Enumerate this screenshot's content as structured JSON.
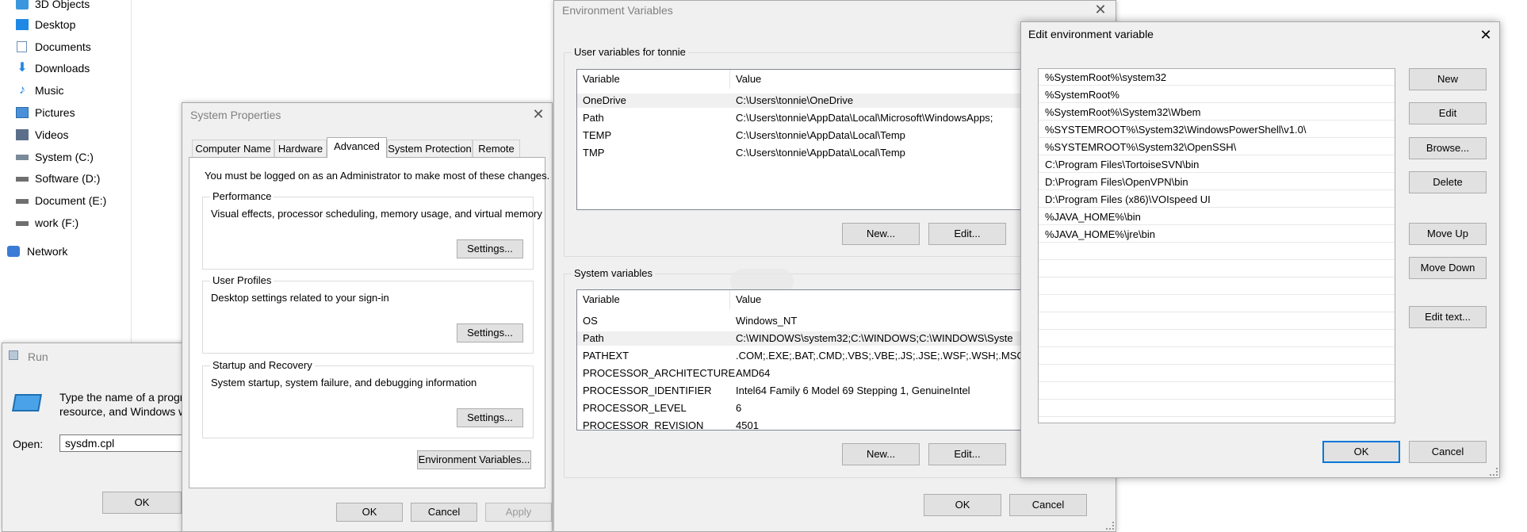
{
  "explorer": {
    "items": [
      {
        "label": "3D Objects",
        "icon": "3d-objects-icon"
      },
      {
        "label": "Desktop",
        "icon": "desktop-icon"
      },
      {
        "label": "Documents",
        "icon": "documents-icon"
      },
      {
        "label": "Downloads",
        "icon": "downloads-icon"
      },
      {
        "label": "Music",
        "icon": "music-icon"
      },
      {
        "label": "Pictures",
        "icon": "pictures-icon"
      },
      {
        "label": "Videos",
        "icon": "videos-icon"
      },
      {
        "label": "System (C:)",
        "icon": "drive-icon"
      },
      {
        "label": "Software (D:)",
        "icon": "drive-icon"
      },
      {
        "label": "Document (E:)",
        "icon": "drive-icon"
      },
      {
        "label": "work (F:)",
        "icon": "drive-icon"
      },
      {
        "label": "Network",
        "icon": "network-icon"
      }
    ]
  },
  "run": {
    "title": "Run",
    "prompt_line1": "Type the name of a progra",
    "prompt_line2": "resource, and Windows w",
    "open_label": "Open:",
    "open_value": "sysdm.cpl",
    "ok_label": "OK"
  },
  "system_properties": {
    "title": "System Properties",
    "tabs": [
      "Computer Name",
      "Hardware",
      "Advanced",
      "System Protection",
      "Remote"
    ],
    "active_tab": "Advanced",
    "admin_note": "You must be logged on as an Administrator to make most of these changes.",
    "performance": {
      "label": "Performance",
      "desc": "Visual effects, processor scheduling, memory usage, and virtual memory",
      "button": "Settings..."
    },
    "user_profiles": {
      "label": "User Profiles",
      "desc": "Desktop settings related to your sign-in",
      "button": "Settings..."
    },
    "startup": {
      "label": "Startup and Recovery",
      "desc": "System startup, system failure, and debugging information",
      "button": "Settings..."
    },
    "env_button": "Environment Variables...",
    "ok": "OK",
    "cancel": "Cancel",
    "apply": "Apply"
  },
  "env_vars": {
    "title": "Environment Variables",
    "user_group": "User variables for tonnie",
    "col_variable": "Variable",
    "col_value": "Value",
    "user_rows": [
      {
        "variable": "OneDrive",
        "value": "C:\\Users\\tonnie\\OneDrive"
      },
      {
        "variable": "Path",
        "value": "C:\\Users\\tonnie\\AppData\\Local\\Microsoft\\WindowsApps;"
      },
      {
        "variable": "TEMP",
        "value": "C:\\Users\\tonnie\\AppData\\Local\\Temp"
      },
      {
        "variable": "TMP",
        "value": "C:\\Users\\tonnie\\AppData\\Local\\Temp"
      }
    ],
    "system_group": "System variables",
    "system_rows": [
      {
        "variable": "OS",
        "value": "Windows_NT"
      },
      {
        "variable": "Path",
        "value": "C:\\WINDOWS\\system32;C:\\WINDOWS;C:\\WINDOWS\\Syste"
      },
      {
        "variable": "PATHEXT",
        "value": ".COM;.EXE;.BAT;.CMD;.VBS;.VBE;.JS;.JSE;.WSF;.WSH;.MSC"
      },
      {
        "variable": "PROCESSOR_ARCHITECTURE",
        "value": "AMD64"
      },
      {
        "variable": "PROCESSOR_IDENTIFIER",
        "value": "Intel64 Family 6 Model 69 Stepping 1, GenuineIntel"
      },
      {
        "variable": "PROCESSOR_LEVEL",
        "value": "6"
      },
      {
        "variable": "PROCESSOR_REVISION",
        "value": "4501"
      }
    ],
    "new": "New...",
    "edit": "Edit...",
    "ok": "OK",
    "cancel": "Cancel"
  },
  "edit_env": {
    "title": "Edit environment variable",
    "paths": [
      "%SystemRoot%\\system32",
      "%SystemRoot%",
      "%SystemRoot%\\System32\\Wbem",
      "%SYSTEMROOT%\\System32\\WindowsPowerShell\\v1.0\\",
      "%SYSTEMROOT%\\System32\\OpenSSH\\",
      "C:\\Program Files\\TortoiseSVN\\bin",
      "D:\\Program Files\\OpenVPN\\bin",
      "D:\\Program Files (x86)\\VOIspeed UI",
      "%JAVA_HOME%\\bin",
      "%JAVA_HOME%\\jre\\bin"
    ],
    "buttons": {
      "new": "New",
      "edit": "Edit",
      "browse": "Browse...",
      "delete": "Delete",
      "move_up": "Move Up",
      "move_down": "Move Down",
      "edit_text": "Edit text..."
    },
    "ok": "OK",
    "cancel": "Cancel"
  },
  "colors": {
    "accent": "#0078d7",
    "window_bg": "#f0f0f0"
  }
}
